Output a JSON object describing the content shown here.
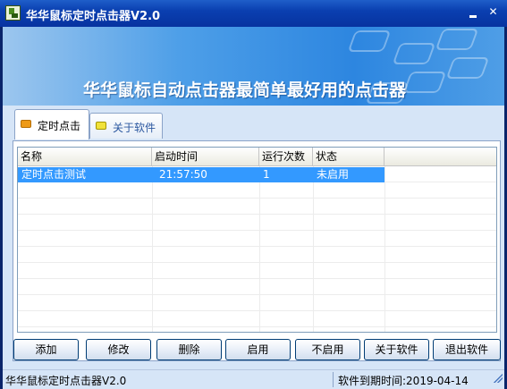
{
  "window": {
    "title": "华华鼠标定时点击器V2.0"
  },
  "banner": {
    "slogan": "华华鼠标自动点击器最简单最好用的点击器"
  },
  "tabs": [
    {
      "label": "定时点击",
      "active": true
    },
    {
      "label": "关于软件",
      "active": false
    }
  ],
  "list": {
    "columns": [
      "名称",
      "启动时间",
      "运行次数",
      "状态"
    ],
    "rows": [
      {
        "name": "定时点击测试",
        "start_time": "21:57:50",
        "run_count": "1",
        "status": "未启用",
        "selected": true
      }
    ]
  },
  "buttons": {
    "add": "添加",
    "edit": "修改",
    "delete": "删除",
    "enable": "启用",
    "disable": "不启用",
    "about": "关于软件",
    "exit": "退出软件"
  },
  "status": {
    "app_name": "华华鼠标定时点击器V2.0",
    "expiry": "软件到期时间:2019-04-14"
  },
  "colors": {
    "titlebar": "#0a3fb0",
    "selection": "#3399ff",
    "window_bg": "#d6e5f7"
  }
}
